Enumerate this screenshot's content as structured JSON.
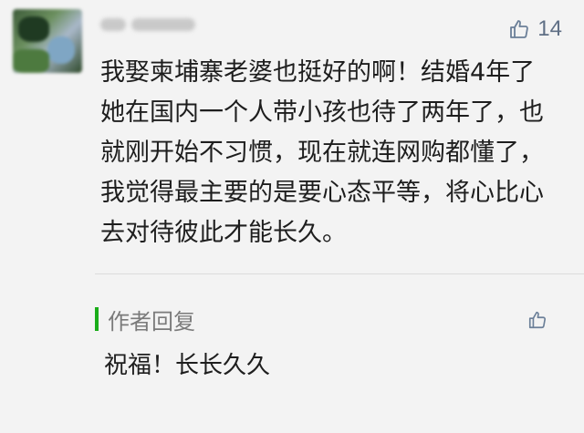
{
  "comment": {
    "avatar_icon": "user-avatar-image",
    "like_icon": "thumbs-up-icon",
    "like_count": "14",
    "text": "我娶柬埔寨老婆也挺好的啊！结婚4年了她在国内一个人带小孩也待了两年了，也就刚开始不习惯，现在就连网购都懂了，我觉得最主要的是要心态平等，将心比心去对待彼此才能长久。"
  },
  "author_reply": {
    "label": "作者回复",
    "accent_color": "#1aad19",
    "like_icon": "thumbs-up-icon",
    "text": "祝福！长长久久"
  }
}
